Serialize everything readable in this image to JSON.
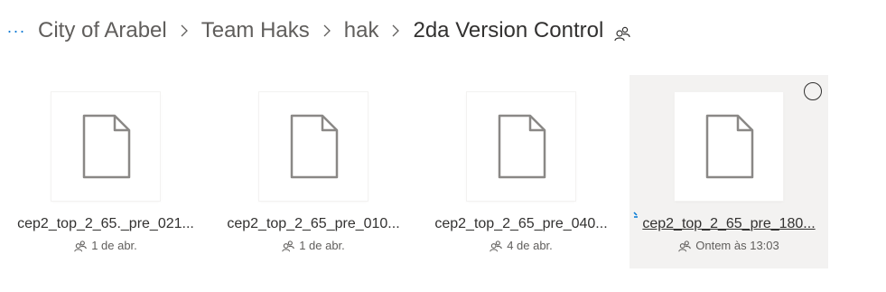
{
  "breadcrumb": {
    "overflow_label": "···",
    "items": [
      {
        "label": "City of Arabel"
      },
      {
        "label": "Team Haks"
      },
      {
        "label": "hak"
      },
      {
        "label": "2da Version Control"
      }
    ]
  },
  "icons": {
    "separator": "chevron-right-icon",
    "shared": "shared-people-icon",
    "file": "document-icon"
  },
  "files": [
    {
      "name": "cep2_top_2_65._pre_021...",
      "modified": "1 de abr.",
      "selected": false
    },
    {
      "name": "cep2_top_2_65_pre_010...",
      "modified": "1 de abr.",
      "selected": false
    },
    {
      "name": "cep2_top_2_65_pre_040...",
      "modified": "4 de abr.",
      "selected": false
    },
    {
      "name": "cep2_top_2_65_pre_180...",
      "modified": "Ontem às 13:03",
      "selected": true
    }
  ],
  "colors": {
    "accent": "#0078d4",
    "selected_bg": "#f3f2f1",
    "text": "#323130",
    "secondary_text": "#605e5c"
  }
}
